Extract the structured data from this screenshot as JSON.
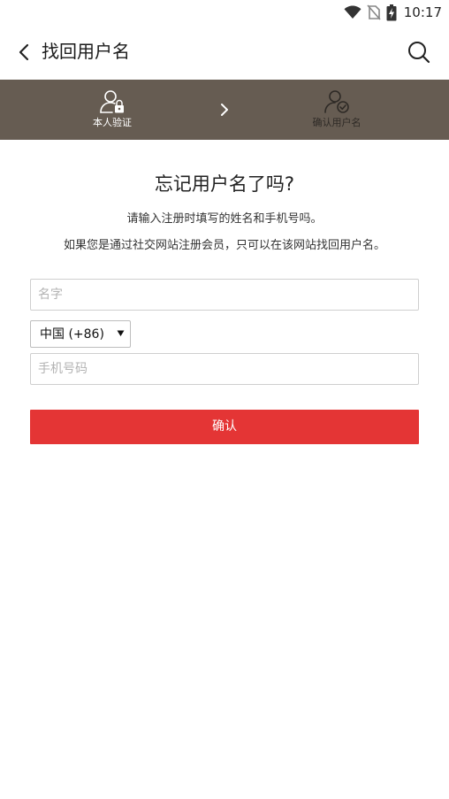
{
  "status_bar": {
    "time": "10:17",
    "icons": [
      "wifi-icon",
      "no-sim-icon",
      "battery-charging-icon"
    ]
  },
  "header": {
    "title": "找回用户名",
    "back_icon": "chevron-left-icon",
    "search_icon": "search-icon"
  },
  "steps": {
    "items": [
      {
        "label": "本人验证",
        "icon": "user-lock-icon",
        "active": true
      },
      {
        "label": "确认用户名",
        "icon": "user-check-icon",
        "active": false
      }
    ],
    "separator_icon": "chevron-right-icon"
  },
  "main": {
    "title": "忘记用户名了吗?",
    "desc_line1": "请输入注册时填写的姓名和手机号吗。",
    "desc_line2": "如果您是通过社交网站注册会员，只可以在该网站找回用户名。"
  },
  "form": {
    "name_placeholder": "名字",
    "country_selected": "中国 (+86)",
    "phone_placeholder": "手机号码",
    "confirm_label": "确认"
  },
  "colors": {
    "steps_bar_bg": "#665c52",
    "confirm_bg": "#e43535"
  }
}
